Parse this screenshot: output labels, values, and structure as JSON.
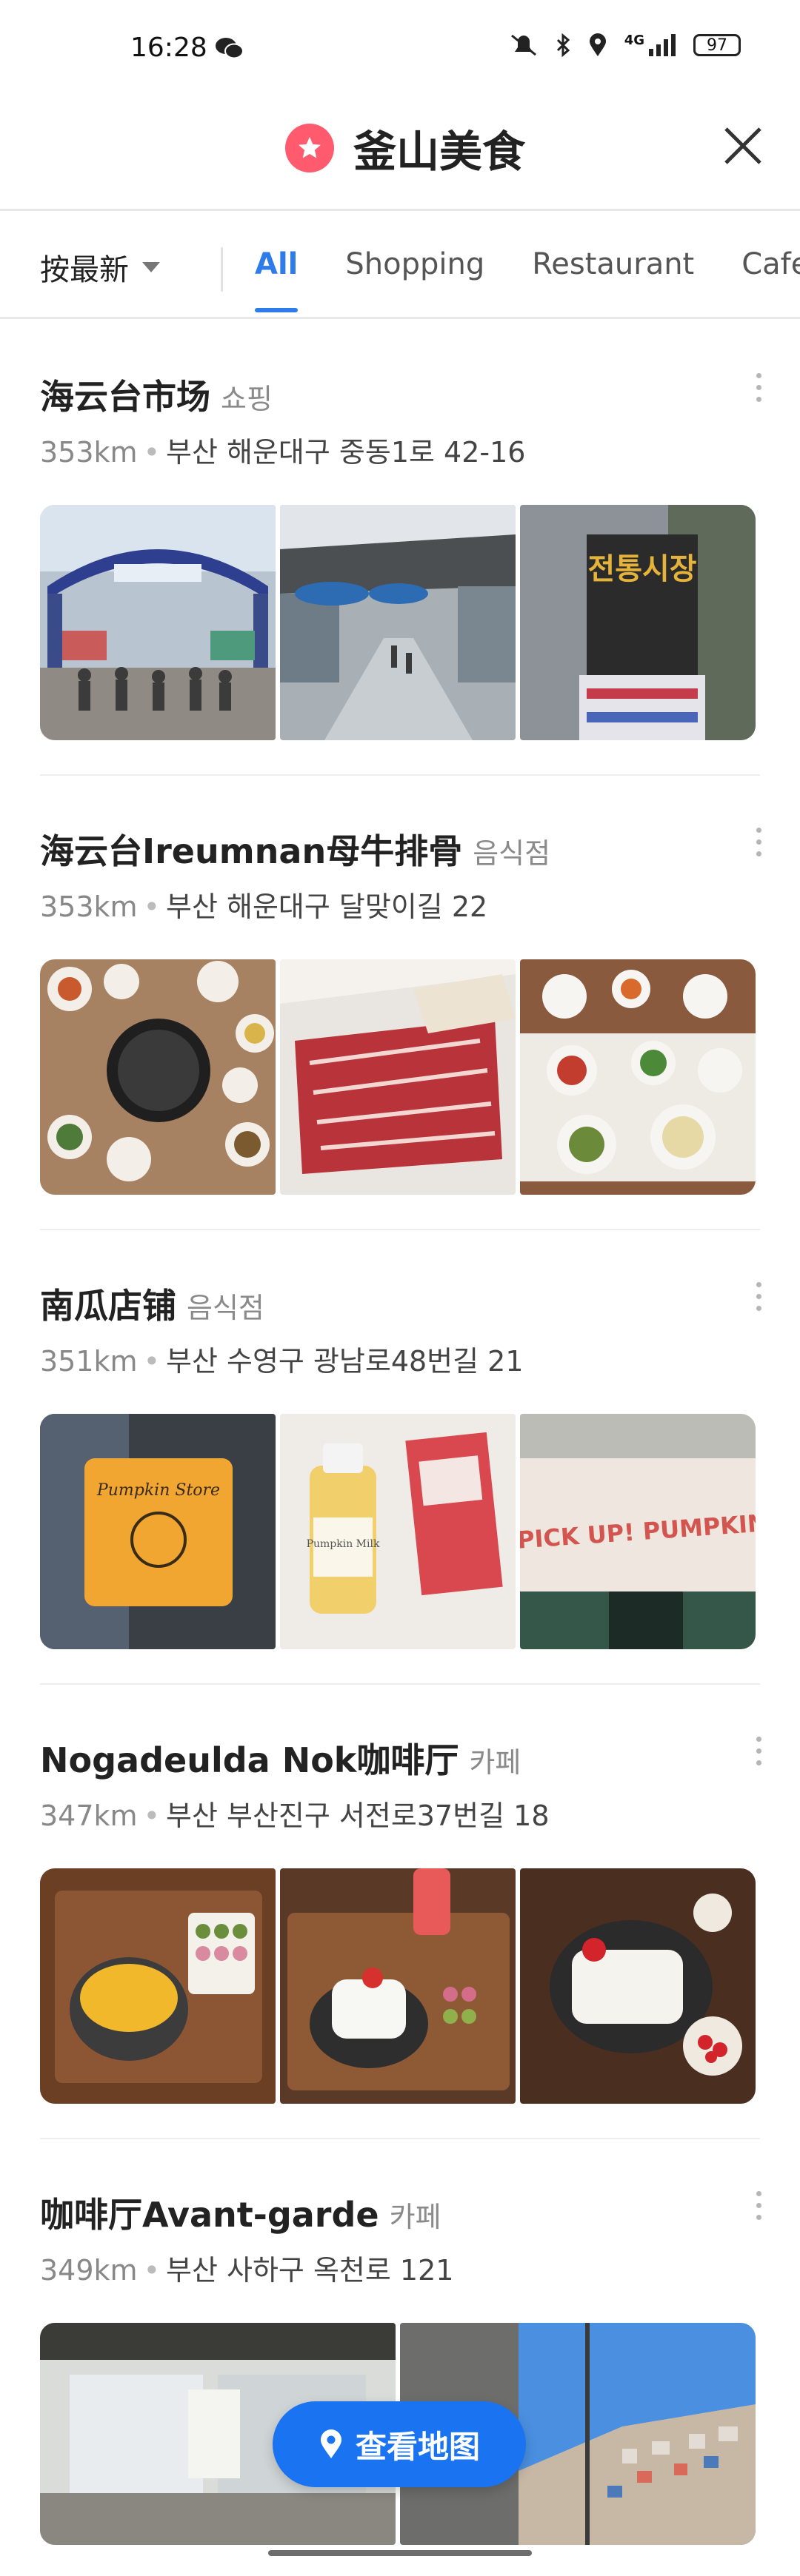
{
  "status_bar": {
    "time": "16:28",
    "signal_label": "4G",
    "battery": "97"
  },
  "header": {
    "title": "釜山美食"
  },
  "filter": {
    "sort_label": "按最新",
    "tabs": [
      {
        "label": "All",
        "active": true
      },
      {
        "label": "Shopping",
        "active": false
      },
      {
        "label": "Restaurant",
        "active": false
      },
      {
        "label": "Cafe",
        "active": false
      }
    ]
  },
  "places": [
    {
      "name": "海云台市场",
      "category": "쇼핑",
      "distance": "353km",
      "address": "부산 해운대구 중동1로 42-16"
    },
    {
      "name": "海云台Ireumnan母牛排骨",
      "category": "음식점",
      "distance": "353km",
      "address": "부산 해운대구 달맞이길 22"
    },
    {
      "name": "南瓜店铺",
      "category": "음식점",
      "distance": "351km",
      "address": "부산 수영구 광남로48번길 21"
    },
    {
      "name": "Nogadeulda Nok咖啡厅",
      "category": "카페",
      "distance": "347km",
      "address": "부산 부산진구 서전로37번길 18"
    },
    {
      "name": "咖啡厅Avant-garde",
      "category": "카페",
      "distance": "349km",
      "address": "부산 사하구 옥천로 121"
    }
  ],
  "photo_text": {
    "market_sign": "전통시장",
    "pumpkin_sign": "PICK UP! PUMPKIN",
    "pumpkin_store": "Pumpkin Store",
    "pumpkin_milk": "Pumpkin Milk"
  },
  "map_button": {
    "label": "查看地图"
  },
  "colors": {
    "accent": "#2e7bea",
    "map_button": "#1a73f0",
    "badge": "#ff5a6e"
  }
}
